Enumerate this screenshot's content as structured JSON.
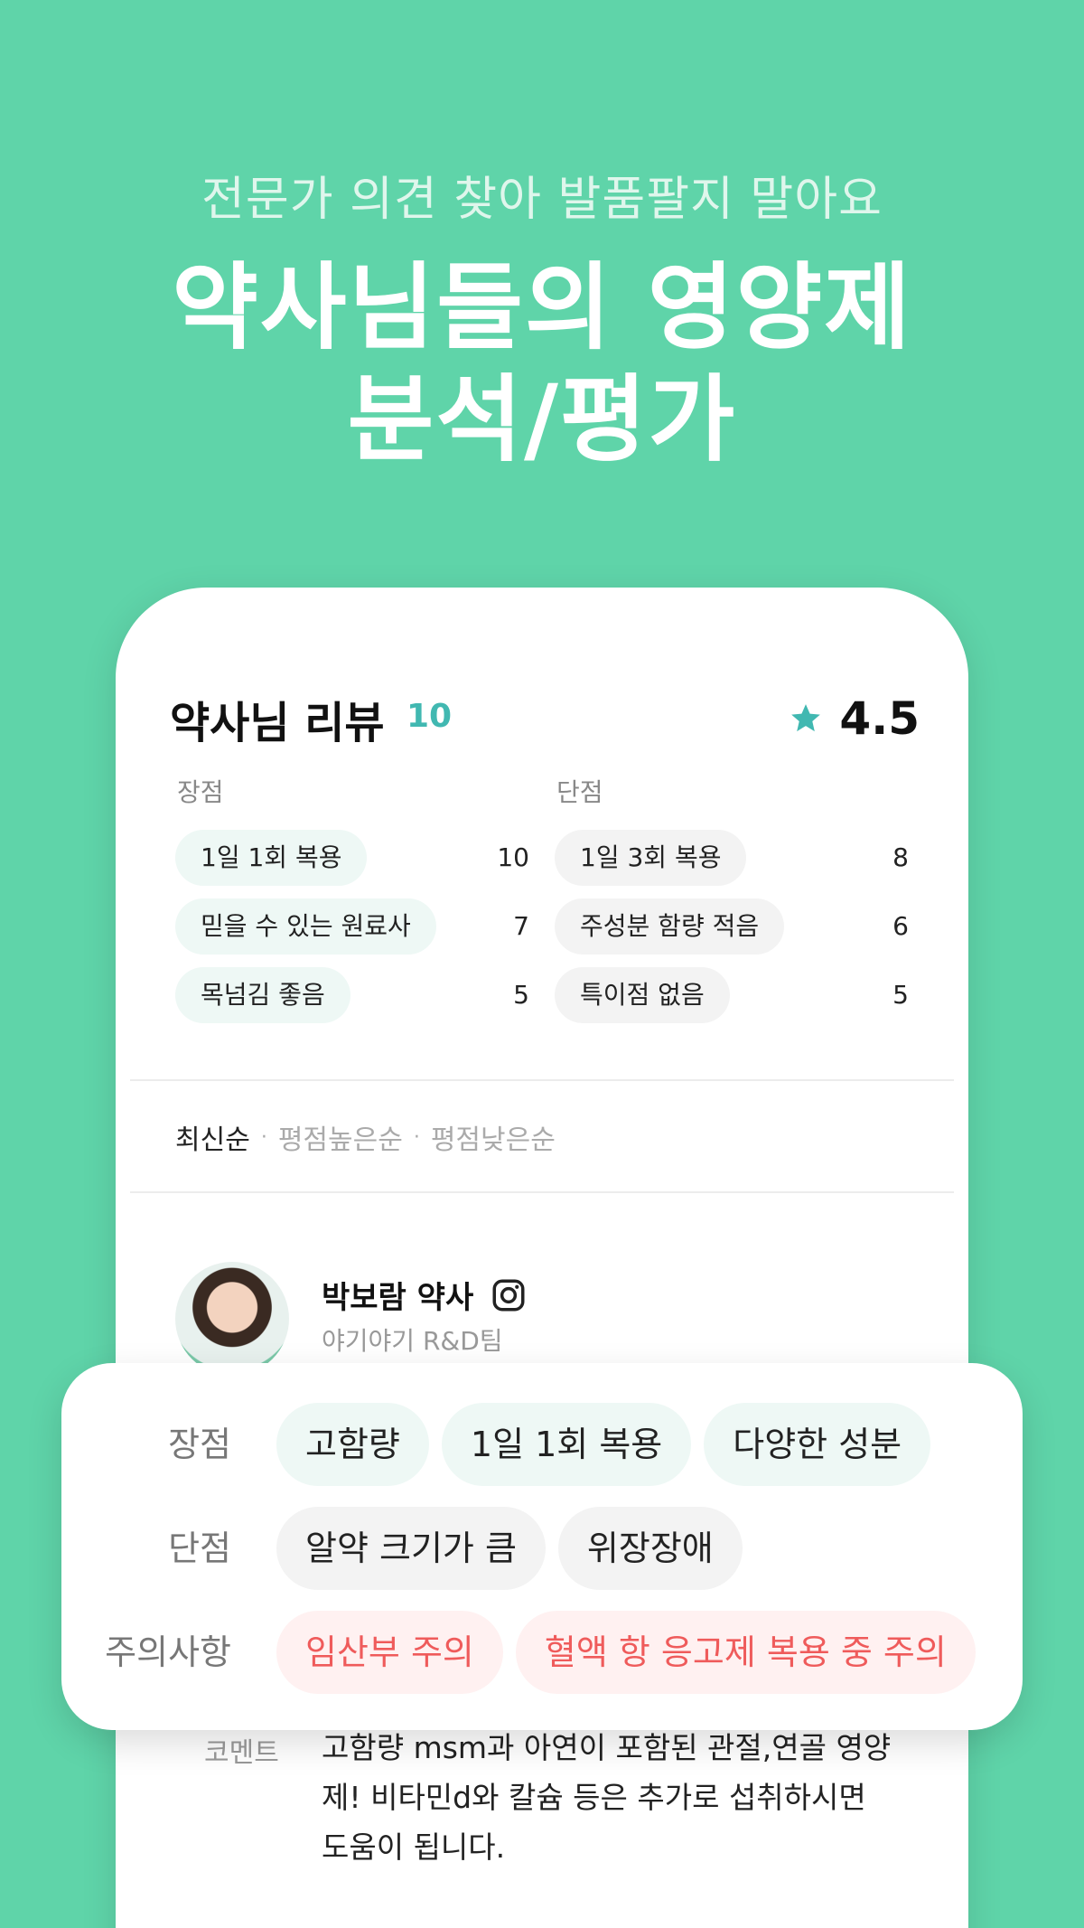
{
  "hero": {
    "subtitle": "전문가 의견 찾아 발품팔지 말아요",
    "title_line1": "약사님들의 영양제",
    "title_line2": "분석/평가"
  },
  "review_summary": {
    "title": "약사님 리뷰",
    "count": "10",
    "rating": "4.5",
    "pros_heading": "장점",
    "cons_heading": "단점",
    "pros": [
      {
        "label": "1일 1회 복용",
        "count": "10"
      },
      {
        "label": "믿을 수 있는 원료사",
        "count": "7"
      },
      {
        "label": "목넘김 좋음",
        "count": "5"
      }
    ],
    "cons": [
      {
        "label": "1일 3회 복용",
        "count": "8"
      },
      {
        "label": "주성분 함량 적음",
        "count": "6"
      },
      {
        "label": "특이점 없음",
        "count": "5"
      }
    ]
  },
  "sort": {
    "active": "최신순",
    "options": [
      "평점높은순",
      "평점낮은순"
    ]
  },
  "reviewer": {
    "name": "박보람 약사",
    "affiliation": "야기야기 R&D팀"
  },
  "review_detail": {
    "pros_label": "장점",
    "pros": [
      "고함량",
      "1일 1회 복용",
      "다양한 성분"
    ],
    "cons_label": "단점",
    "cons": [
      "알약 크기가 큼",
      "위장장애"
    ],
    "caution_label": "주의사항",
    "cautions": [
      "임산부 주의",
      "혈액 항 응고제 복용 중 주의"
    ]
  },
  "comment": {
    "label": "코멘트",
    "text": "고함량 msm과 아연이 포함된 관절,연골 영양제! 비타민d와 칼슘 등은 추가로 섭취하시면 도움이 됩니다."
  },
  "colors": {
    "background": "#5fd4a9",
    "accent": "#41b8b1",
    "pro_chip": "#eef8f5",
    "caution_text": "#ef5b5b"
  }
}
